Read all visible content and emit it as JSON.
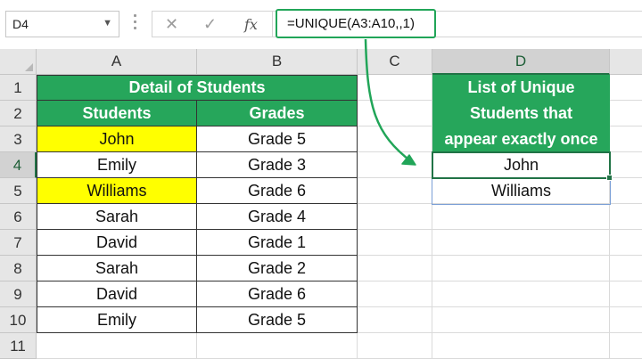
{
  "formula_bar": {
    "name_box": "D4",
    "cancel_icon": "x-icon",
    "enter_icon": "check-icon",
    "function_icon": "fx",
    "formula": "=UNIQUE(A3:A10,,1)"
  },
  "columns": [
    "A",
    "B",
    "C",
    "D"
  ],
  "rows": [
    "1",
    "2",
    "3",
    "4",
    "5",
    "6",
    "7",
    "8",
    "9",
    "10",
    "11"
  ],
  "table": {
    "title": "Detail of Students",
    "headers": [
      "Students",
      "Grades"
    ],
    "rows": [
      {
        "student": "John",
        "grade": "Grade 5",
        "highlight": true
      },
      {
        "student": "Emily",
        "grade": "Grade 3",
        "highlight": false
      },
      {
        "student": "Williams",
        "grade": "Grade 6",
        "highlight": true
      },
      {
        "student": "Sarah",
        "grade": "Grade 4",
        "highlight": false
      },
      {
        "student": "David",
        "grade": "Grade 1",
        "highlight": false
      },
      {
        "student": "Sarah",
        "grade": "Grade 2",
        "highlight": false
      },
      {
        "student": "David",
        "grade": "Grade 6",
        "highlight": false
      },
      {
        "student": "Emily",
        "grade": "Grade 5",
        "highlight": false
      }
    ]
  },
  "unique_list": {
    "header_lines": [
      "List of Unique",
      "Students that",
      "appear exactly once"
    ],
    "values": [
      "John",
      "Williams"
    ]
  },
  "colors": {
    "header_green": "#26a65b",
    "highlight_yellow": "#ffff00",
    "selection_green": "#217346",
    "arrow_green": "#21a558"
  }
}
